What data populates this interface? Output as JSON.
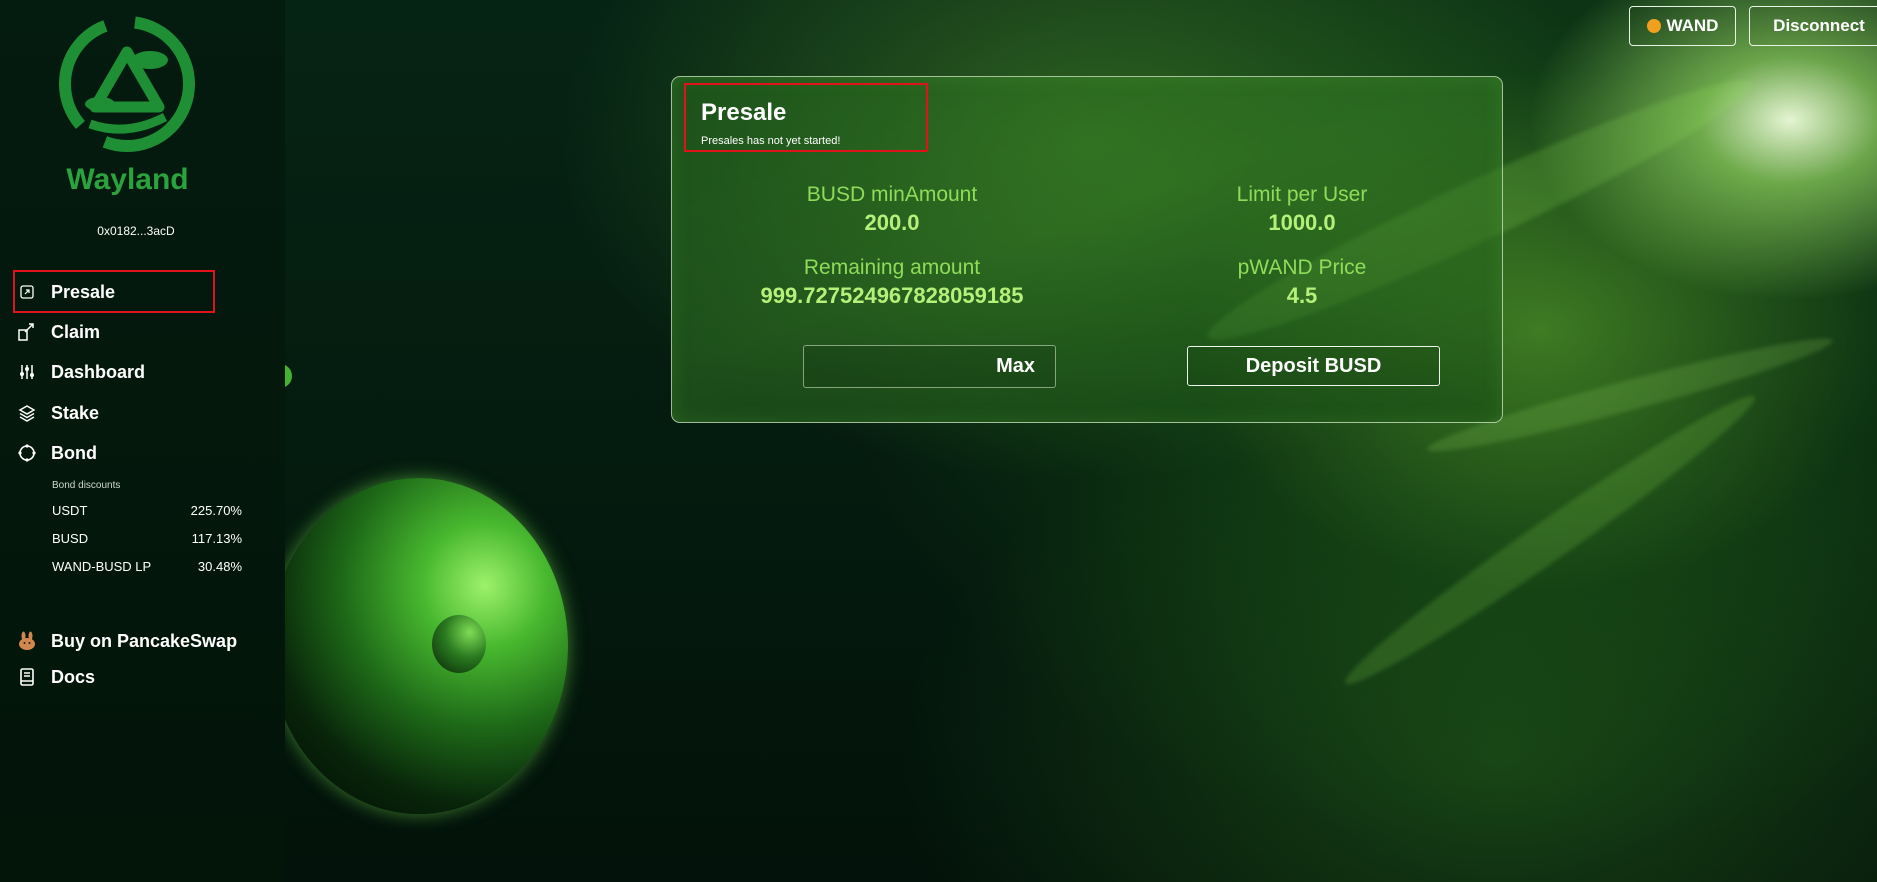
{
  "app": {
    "brand": "Wayland",
    "wallet_address": "0x0182...3acD"
  },
  "topbar": {
    "token_label": "WAND",
    "disconnect_label": "Disconnect"
  },
  "sidebar": {
    "items": [
      {
        "label": "Presale",
        "icon": "external-link-icon"
      },
      {
        "label": "Claim",
        "icon": "claim-icon"
      },
      {
        "label": "Dashboard",
        "icon": "sliders-icon"
      },
      {
        "label": "Stake",
        "icon": "layers-icon"
      },
      {
        "label": "Bond",
        "icon": "bond-icon"
      }
    ],
    "bond_discounts": {
      "title": "Bond discounts",
      "rows": [
        {
          "name": "USDT",
          "value": "225.70%"
        },
        {
          "name": "BUSD",
          "value": "117.13%"
        },
        {
          "name": "WAND-BUSD LP",
          "value": "30.48%"
        }
      ]
    },
    "links": [
      {
        "label": "Buy on PancakeSwap",
        "icon": "pancake-icon"
      },
      {
        "label": "Docs",
        "icon": "book-icon"
      }
    ]
  },
  "presale": {
    "title": "Presale",
    "status": "Presales has not yet started!",
    "stats": [
      {
        "label": "BUSD minAmount",
        "value": "200.0"
      },
      {
        "label": "Limit per User",
        "value": "1000.0"
      },
      {
        "label": "Remaining amount",
        "value": "999.727524967828059185"
      },
      {
        "label": "pWAND Price",
        "value": "4.5"
      }
    ],
    "amount_placeholder": "",
    "max_label": "Max",
    "deposit_label": "Deposit BUSD"
  },
  "colors": {
    "accent_green": "#8fdc5a",
    "brand_green": "#2aa33f",
    "highlight_red": "#e0131a",
    "token_dot": "#f0a01e"
  }
}
